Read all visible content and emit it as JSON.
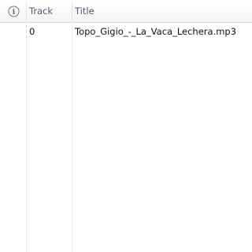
{
  "columns": {
    "info_icon": "info-icon",
    "track": "Track",
    "title": "Title"
  },
  "rows": [
    {
      "track": "0",
      "title": "Topo_Gigio_-_La_Vaca_Lechera.mp3"
    }
  ]
}
